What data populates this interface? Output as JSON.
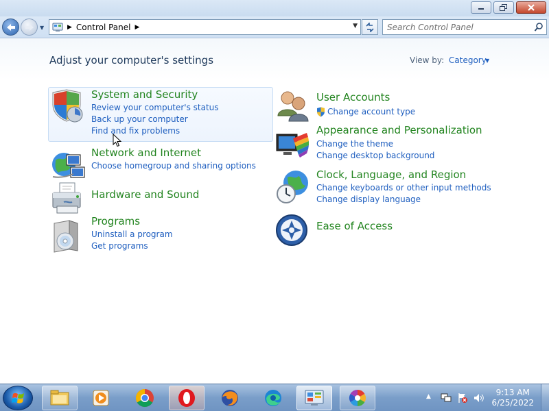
{
  "address_bar": {
    "breadcrumb": "Control Panel",
    "search_placeholder": "Search Control Panel"
  },
  "page": {
    "title": "Adjust your computer's settings",
    "view_by_label": "View by:",
    "view_by_value": "Category"
  },
  "categories": [
    {
      "title": "System and Security",
      "icon": "shield-icon",
      "links": [
        "Review your computer's status",
        "Back up your computer",
        "Find and fix problems"
      ]
    },
    {
      "title": "Network and Internet",
      "icon": "globe-network-icon",
      "links": [
        "Choose homegroup and sharing options"
      ]
    },
    {
      "title": "Hardware and Sound",
      "icon": "printer-icon",
      "links": []
    },
    {
      "title": "Programs",
      "icon": "programs-icon",
      "links": [
        "Uninstall a program",
        "Get programs"
      ]
    },
    {
      "title": "User Accounts",
      "icon": "users-icon",
      "links": [
        "Change account type"
      ]
    },
    {
      "title": "Appearance and Personalization",
      "icon": "monitor-palette-icon",
      "links": [
        "Change the theme",
        "Change desktop background"
      ]
    },
    {
      "title": "Clock, Language, and Region",
      "icon": "clock-globe-icon",
      "links": [
        "Change keyboards or other input methods",
        "Change display language"
      ]
    },
    {
      "title": "Ease of Access",
      "icon": "ease-of-access-icon",
      "links": []
    }
  ],
  "taskbar": {
    "apps": [
      "file-explorer-icon",
      "media-player-icon",
      "chrome-icon",
      "opera-icon",
      "firefox-icon",
      "edge-icon",
      "control-panel-icon",
      "photos-icon"
    ],
    "clock": {
      "time": "9:13 AM",
      "date": "6/25/2022"
    }
  },
  "colors": {
    "category_title": "#22841f",
    "link": "#1e5ebf",
    "heading": "#1e395b"
  }
}
